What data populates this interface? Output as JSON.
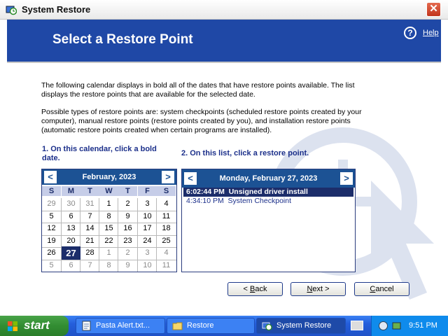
{
  "window": {
    "title": "System Restore",
    "close_glyph": "✕"
  },
  "header": {
    "title": "Select a Restore Point",
    "help_glyph": "?",
    "help_label": "Help"
  },
  "intro": {
    "p1": "The following calendar displays in bold all of the dates that have restore points available. The list displays the restore points that are available for the selected date.",
    "p2": "Possible types of restore points are: system checkpoints (scheduled restore points created by your computer), manual restore points (restore points created by you), and installation restore points (automatic restore points created when certain programs are installed)."
  },
  "steps": {
    "step1": "1. On this calendar, click a bold date.",
    "step2": "2. On this list, click a restore point."
  },
  "calendar": {
    "month_label": "February, 2023",
    "prev_glyph": "<",
    "next_glyph": ">",
    "weekdays": [
      "S",
      "M",
      "T",
      "W",
      "T",
      "F",
      "S"
    ],
    "weeks": [
      [
        "29",
        "30",
        "31",
        "1",
        "2",
        "3",
        "4"
      ],
      [
        "5",
        "6",
        "7",
        "8",
        "9",
        "10",
        "11"
      ],
      [
        "12",
        "13",
        "14",
        "15",
        "16",
        "17",
        "18"
      ],
      [
        "19",
        "20",
        "21",
        "22",
        "23",
        "24",
        "25"
      ],
      [
        "26",
        "27",
        "28",
        "1",
        "2",
        "3",
        "4"
      ],
      [
        "5",
        "6",
        "7",
        "8",
        "9",
        "10",
        "11"
      ]
    ],
    "selected_day": "27"
  },
  "restore_list": {
    "date_label": "Monday, February 27, 2023",
    "prev_glyph": "<",
    "next_glyph": ">",
    "items": [
      {
        "time": "6:02:44 PM",
        "description": "Unsigned driver install",
        "selected": true
      },
      {
        "time": "4:34:10 PM",
        "description": "System Checkpoint",
        "selected": false
      }
    ]
  },
  "buttons": {
    "back": {
      "prefix": "< ",
      "key": "B",
      "rest": "ack"
    },
    "next": {
      "label": "Next >",
      "key": "N",
      "rest": "ext >"
    },
    "cancel": {
      "key": "C",
      "rest": "ancel"
    }
  },
  "taskbar": {
    "start_label": "start",
    "tasks": [
      "Pasta Alert.txt...",
      "Restore",
      "System Restore"
    ],
    "active_task": "System Restore",
    "clock": "9:51 PM"
  },
  "colors": {
    "header_blue": "#1f48a6",
    "calendar_blue": "#1c5294",
    "selection_navy": "#1c2d6a",
    "taskbar_blue": "#245edb",
    "start_green": "#328d32"
  },
  "icons": [
    "system-restore-icon",
    "close-icon",
    "help-icon",
    "chevron-left-icon",
    "chevron-right-icon",
    "windows-flag-icon",
    "notepad-icon",
    "folder-icon",
    "keyboard-icon",
    "tray-icon"
  ]
}
